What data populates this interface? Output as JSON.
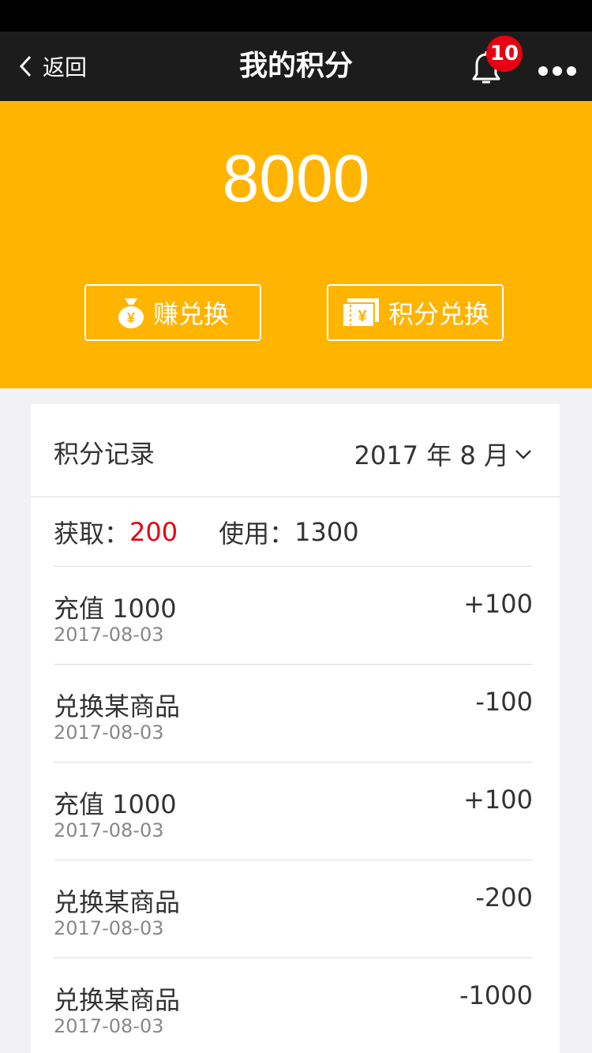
{
  "nav": {
    "back_label": "返回",
    "title": "我的积分",
    "notification_count": "10"
  },
  "header": {
    "points_total": "8000",
    "earn_button_label": "赚兑换",
    "redeem_button_label": "积分兑换"
  },
  "records": {
    "title": "积分记录",
    "month": "2017 年 8 月",
    "summary": {
      "earn_label": "获取：",
      "earn_value": "200",
      "use_label": "使用：",
      "use_value": "1300"
    },
    "items": [
      {
        "title": "充值 1000",
        "date": "2017-08-03",
        "amount": "+100"
      },
      {
        "title": "兑换某商品",
        "date": "2017-08-03",
        "amount": "-100"
      },
      {
        "title": "充值 1000",
        "date": "2017-08-03",
        "amount": "+100"
      },
      {
        "title": "兑换某商品",
        "date": "2017-08-03",
        "amount": "-200"
      },
      {
        "title": "兑换某商品",
        "date": "2017-08-03",
        "amount": "-1000"
      }
    ]
  },
  "colors": {
    "header_bg": "#ffb400",
    "nav_bg": "#1c1c1c",
    "badge": "#e60012",
    "earn_value": "#e60012"
  },
  "icons": {
    "back": "chevron-left-icon",
    "bell": "bell-icon",
    "more": "more-dots-icon",
    "earn": "money-bag-icon",
    "redeem": "ticket-icon",
    "month": "chevron-down-icon"
  }
}
